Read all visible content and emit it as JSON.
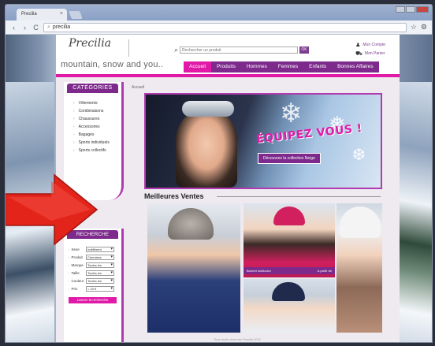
{
  "browser": {
    "tab_title": "Precilia",
    "tab_close": "×",
    "url": "precilia",
    "back_icon": "‹",
    "forward_icon": "›",
    "reload_icon": "C"
  },
  "site": {
    "logo_text": "Precilia",
    "tagline": "mountain, snow and you..",
    "search_placeholder": "Rechercher un produit",
    "search_button": "OK",
    "account_link": "Mon Compte",
    "cart_link": "Mon Panier",
    "menu": [
      {
        "label": "Accueil",
        "active": true
      },
      {
        "label": "Produits"
      },
      {
        "label": "Hommes"
      },
      {
        "label": "Femmes"
      },
      {
        "label": "Enfants"
      },
      {
        "label": "Bonnes Affaires"
      }
    ],
    "breadcrumb": "Accueil"
  },
  "categories": {
    "title": "CATÉGORIES",
    "items": [
      "Vêtements",
      "Combinaisons",
      "Chaussures",
      "Accessoires",
      "Bagages",
      "Sports individuels",
      "Sports collectifs"
    ]
  },
  "search_panel": {
    "title": "RECHERCHE",
    "filters": [
      {
        "label": "Sexe",
        "value": "Indifférent"
      },
      {
        "label": "Produit",
        "value": "Chemises"
      },
      {
        "label": "Marque",
        "value": "Toutes les"
      },
      {
        "label": "Taille",
        "value": "Toutes les"
      },
      {
        "label": "Couleur",
        "value": "Toutes les"
      },
      {
        "label": "Prix",
        "value": "< 20 €"
      }
    ],
    "button": "Lancer la recherche"
  },
  "banner": {
    "headline": "ÉQUIPEZ VOUS !",
    "cta": "Découvrez la collection Neige"
  },
  "best_sellers": {
    "title": "Meilleures Ventes",
    "caption_left": "Bonnet multicolor",
    "caption_right": "A partir de"
  },
  "footer": "Tous droits réservés Precilia 2012",
  "colors": {
    "brand_purple": "#7d2a8c",
    "accent_pink": "#e01aa7",
    "arrow_red": "#e3241b"
  }
}
